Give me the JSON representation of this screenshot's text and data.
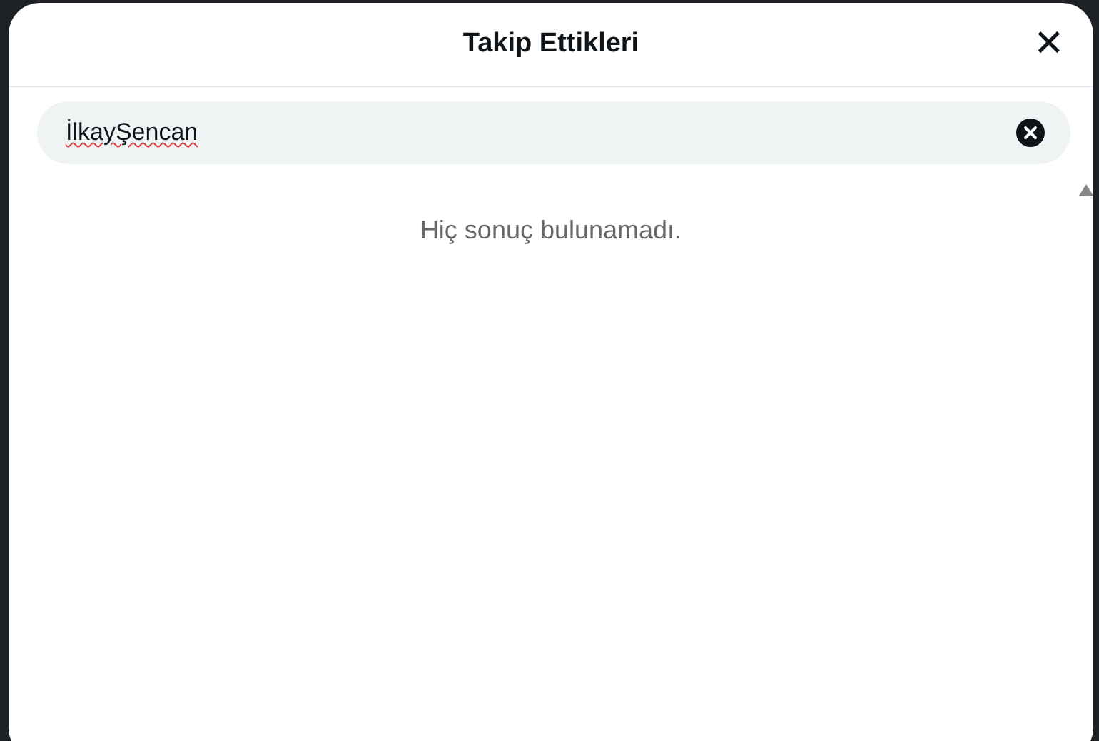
{
  "dialog": {
    "title": "Takip Ettikleri",
    "close": "✕"
  },
  "search": {
    "value": "İlkayŞencan",
    "misspelled": true
  },
  "message": "Hiç sonuç bulunamadı."
}
